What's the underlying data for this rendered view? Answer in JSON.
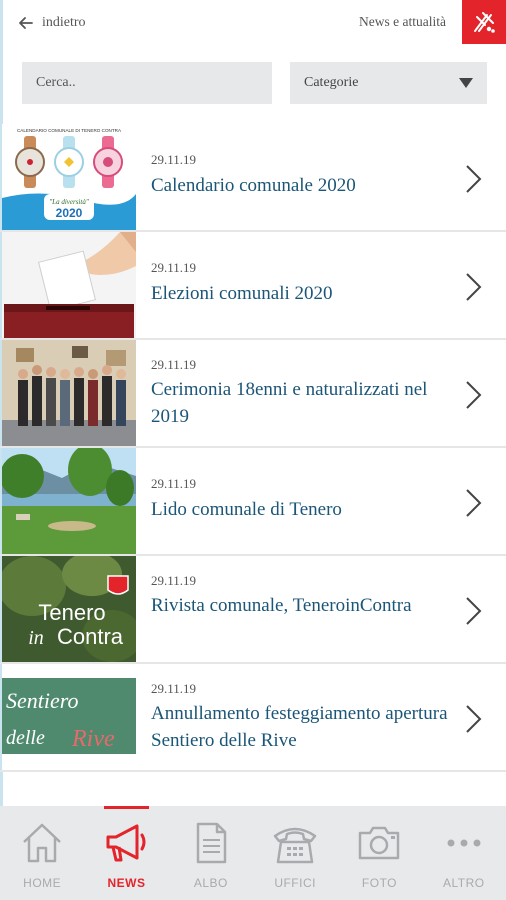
{
  "header": {
    "back_label": "indietro",
    "section_title": "News e attualità"
  },
  "search": {
    "placeholder": "Cerca.."
  },
  "filter": {
    "category_label": "Categorie"
  },
  "news": [
    {
      "date": "29.11.19",
      "title": "Calendario comunale 2020",
      "thumb_text_top": "CALENDARIO COMUNALE DI TENERO CONTRA",
      "thumb_text_script": "\"La diversità\"",
      "thumb_text_year": "2020"
    },
    {
      "date": "29.11.19",
      "title": "Elezioni comunali 2020"
    },
    {
      "date": "29.11.19",
      "title": "Cerimonia 18enni e naturalizzati nel 2019"
    },
    {
      "date": "29.11.19",
      "title": "Lido comunale di Tenero"
    },
    {
      "date": "29.11.19",
      "title": "Rivista comunale, TeneroinContra",
      "thumb_text_a": "Tenero",
      "thumb_text_b": "in",
      "thumb_text_c": "Contra"
    },
    {
      "date": "29.11.19",
      "title": "Annullamento festeggiamento apertura Sentiero delle Rive",
      "thumb_text_a": "Sentiero",
      "thumb_text_b": "delle",
      "thumb_text_c": "Rive"
    }
  ],
  "nav": [
    {
      "label": "HOME",
      "icon": "home-icon",
      "active": false
    },
    {
      "label": "NEWS",
      "icon": "megaphone-icon",
      "active": true
    },
    {
      "label": "ALBO",
      "icon": "document-icon",
      "active": false
    },
    {
      "label": "UFFICI",
      "icon": "phone-icon",
      "active": false
    },
    {
      "label": "FOTO",
      "icon": "camera-icon",
      "active": false
    },
    {
      "label": "ALTRO",
      "icon": "more-icon",
      "active": false
    }
  ],
  "colors": {
    "accent": "#e3242b",
    "title_text": "#1b5577",
    "nav_background": "#e8e9eb",
    "nav_inactive": "#a8abae"
  }
}
